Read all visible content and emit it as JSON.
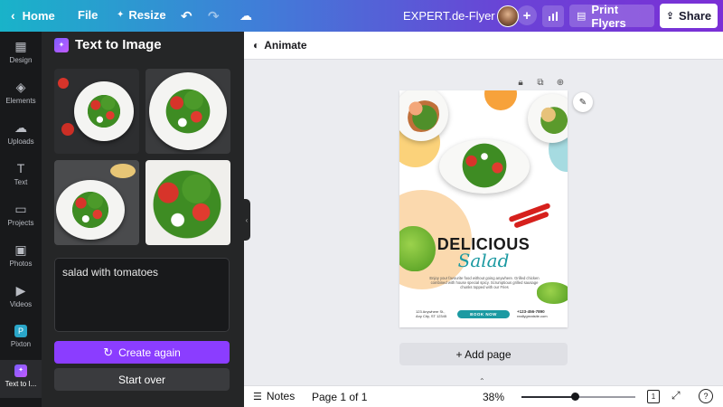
{
  "topbar": {
    "home_label": "Home",
    "file_label": "File",
    "resize_label": "Resize",
    "doc_title": "EXPERT.de-Flyer",
    "print_label": "Print Flyers",
    "share_label": "Share"
  },
  "rail": {
    "items": [
      {
        "label": "Design",
        "icon": "design-icon"
      },
      {
        "label": "Elements",
        "icon": "elements-icon"
      },
      {
        "label": "Uploads",
        "icon": "uploads-icon"
      },
      {
        "label": "Text",
        "icon": "text-icon"
      },
      {
        "label": "Projects",
        "icon": "projects-icon"
      },
      {
        "label": "Photos",
        "icon": "photos-icon"
      },
      {
        "label": "Videos",
        "icon": "videos-icon"
      },
      {
        "label": "Pixton",
        "icon": "pixton-icon"
      },
      {
        "label": "Text to I...",
        "icon": "text-to-image-icon"
      }
    ]
  },
  "panel": {
    "title": "Text to Image",
    "prompt_text": "salad with tomatoes",
    "create_again_label": "Create again",
    "start_over_label": "Start over"
  },
  "canvas": {
    "animate_label": "Animate",
    "add_page_label": "+ Add page"
  },
  "flyer": {
    "heading": "DELICIOUS",
    "script": "Salad",
    "body": "Enjoy your favourite food without going anywhere. Grilled chicken combined with house special spicy. Scrumptious grilled sausage chunks topped with our Fries",
    "address_line1": "123 Anywhere St.,",
    "address_line2": "Any City, ST 12345",
    "book_label": "BOOK NOW",
    "phone": "+123-456-7890",
    "website": "reallygreatsite.com"
  },
  "bottombar": {
    "notes_label": "Notes",
    "page_info": "Page 1 of 1",
    "zoom_label": "38%",
    "zoom_level": 0.38,
    "pages_count": "1"
  },
  "colors": {
    "accent": "#8b3dff",
    "teal": "#1c9aa2"
  }
}
